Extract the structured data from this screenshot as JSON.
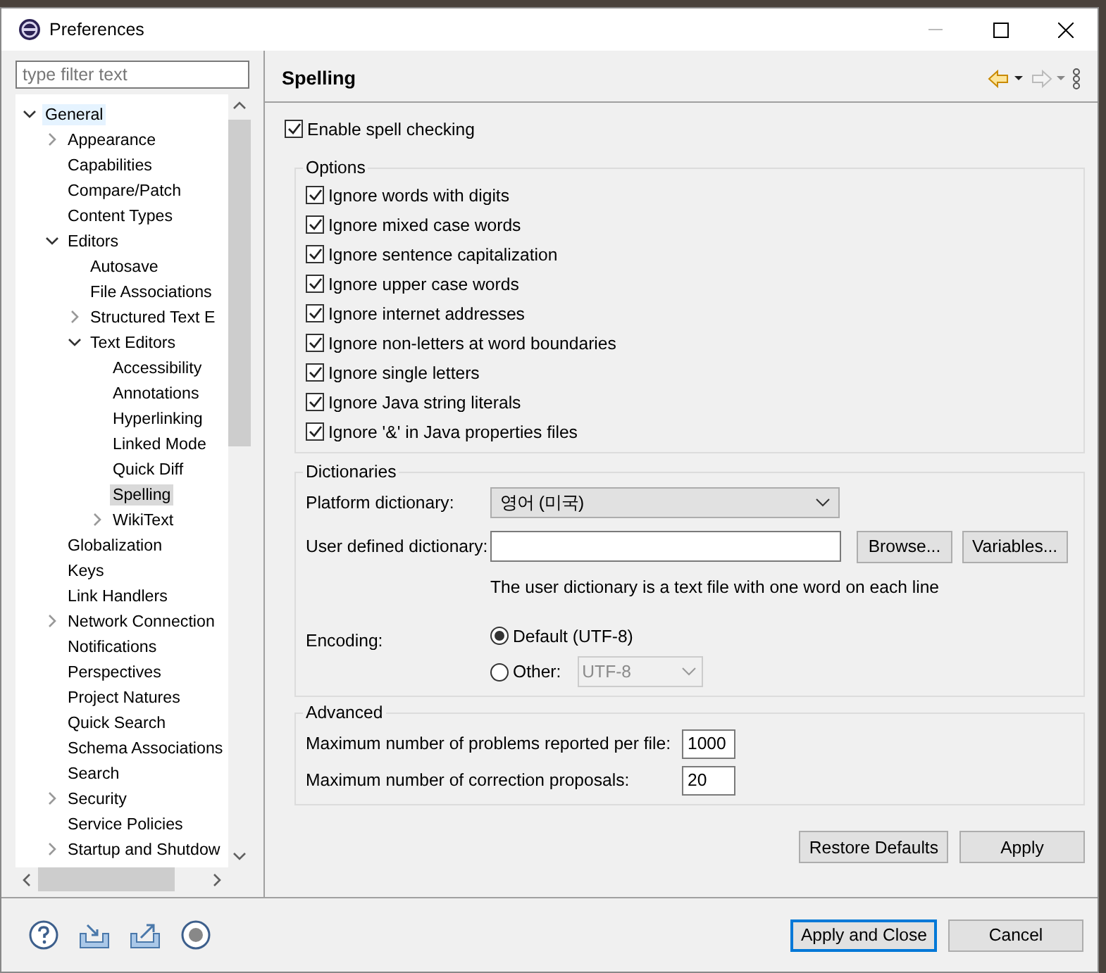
{
  "window": {
    "title": "Preferences"
  },
  "filter": {
    "placeholder": "type filter text"
  },
  "tree": [
    {
      "label": "General",
      "kind": "branch",
      "expanded": true,
      "selected": false,
      "hovered": true,
      "children": [
        {
          "label": "Appearance",
          "kind": "branch",
          "expanded": false,
          "selected": false,
          "hovered": false
        },
        {
          "label": "Capabilities",
          "kind": "leaf",
          "selected": false,
          "hovered": false
        },
        {
          "label": "Compare/Patch",
          "kind": "leaf",
          "selected": false,
          "hovered": false
        },
        {
          "label": "Content Types",
          "kind": "leaf",
          "selected": false,
          "hovered": false
        },
        {
          "label": "Editors",
          "kind": "branch",
          "expanded": true,
          "selected": false,
          "hovered": false,
          "children": [
            {
              "label": "Autosave",
              "kind": "leaf",
              "selected": false,
              "hovered": false
            },
            {
              "label": "File Associations",
              "kind": "leaf",
              "selected": false,
              "hovered": false
            },
            {
              "label": "Structured Text E",
              "kind": "branch",
              "expanded": false,
              "selected": false,
              "hovered": false
            },
            {
              "label": "Text Editors",
              "kind": "branch",
              "expanded": true,
              "selected": false,
              "hovered": false,
              "children": [
                {
                  "label": "Accessibility",
                  "kind": "leaf",
                  "selected": false,
                  "hovered": false
                },
                {
                  "label": "Annotations",
                  "kind": "leaf",
                  "selected": false,
                  "hovered": false
                },
                {
                  "label": "Hyperlinking",
                  "kind": "leaf",
                  "selected": false,
                  "hovered": false
                },
                {
                  "label": "Linked Mode",
                  "kind": "leaf",
                  "selected": false,
                  "hovered": false
                },
                {
                  "label": "Quick Diff",
                  "kind": "leaf",
                  "selected": false,
                  "hovered": false
                },
                {
                  "label": "Spelling",
                  "kind": "leaf",
                  "selected": true,
                  "hovered": false
                },
                {
                  "label": "WikiText",
                  "kind": "branch",
                  "expanded": false,
                  "selected": false,
                  "hovered": false
                }
              ]
            }
          ]
        },
        {
          "label": "Globalization",
          "kind": "leaf",
          "selected": false,
          "hovered": false
        },
        {
          "label": "Keys",
          "kind": "leaf",
          "selected": false,
          "hovered": false
        },
        {
          "label": "Link Handlers",
          "kind": "leaf",
          "selected": false,
          "hovered": false
        },
        {
          "label": "Network Connection",
          "kind": "branch",
          "expanded": false,
          "selected": false,
          "hovered": false
        },
        {
          "label": "Notifications",
          "kind": "leaf",
          "selected": false,
          "hovered": false
        },
        {
          "label": "Perspectives",
          "kind": "leaf",
          "selected": false,
          "hovered": false
        },
        {
          "label": "Project Natures",
          "kind": "leaf",
          "selected": false,
          "hovered": false
        },
        {
          "label": "Quick Search",
          "kind": "leaf",
          "selected": false,
          "hovered": false
        },
        {
          "label": "Schema Associations",
          "kind": "leaf",
          "selected": false,
          "hovered": false
        },
        {
          "label": "Search",
          "kind": "leaf",
          "selected": false,
          "hovered": false
        },
        {
          "label": "Security",
          "kind": "branch",
          "expanded": false,
          "selected": false,
          "hovered": false
        },
        {
          "label": "Service Policies",
          "kind": "leaf",
          "selected": false,
          "hovered": false
        },
        {
          "label": "Startup and Shutdow",
          "kind": "branch",
          "expanded": false,
          "selected": false,
          "hovered": false
        }
      ]
    }
  ],
  "page": {
    "title": "Spelling",
    "back_enabled": true,
    "forward_enabled": false
  },
  "enable_spell_checking": {
    "label": "Enable spell checking",
    "checked": true
  },
  "options": {
    "title": "Options",
    "items": [
      {
        "label": "Ignore words with digits",
        "checked": true
      },
      {
        "label": "Ignore mixed case words",
        "checked": true
      },
      {
        "label": "Ignore sentence capitalization",
        "checked": true
      },
      {
        "label": "Ignore upper case words",
        "checked": true
      },
      {
        "label": "Ignore internet addresses",
        "checked": true
      },
      {
        "label": "Ignore non-letters at word boundaries",
        "checked": true
      },
      {
        "label": "Ignore single letters",
        "checked": true
      },
      {
        "label": "Ignore Java string literals",
        "checked": true
      },
      {
        "label": "Ignore '&' in Java properties files",
        "checked": true
      }
    ]
  },
  "dictionaries": {
    "title": "Dictionaries",
    "platform_label": "Platform dictionary:",
    "platform_value": "영어 (미국)",
    "user_label": "User defined dictionary:",
    "browse": "Browse...",
    "variables": "Variables...",
    "note": "The user dictionary is a text file with one word on each line",
    "encoding_label": "Encoding:",
    "encoding_options": [
      {
        "label": "Default (UTF-8)",
        "selected": true
      },
      {
        "label": "Other:",
        "selected": false
      }
    ],
    "other_value": "UTF-8"
  },
  "advanced": {
    "title": "Advanced",
    "fields": [
      {
        "label": "Maximum number of problems reported per file:",
        "value": "1000"
      },
      {
        "label": "Maximum number of correction proposals:",
        "value": "20"
      }
    ]
  },
  "page_buttons": [
    "Restore Defaults",
    "Apply"
  ],
  "dialog_buttons": [
    {
      "label": "Apply and Close",
      "default": true
    },
    {
      "label": "Cancel",
      "default": false
    }
  ]
}
